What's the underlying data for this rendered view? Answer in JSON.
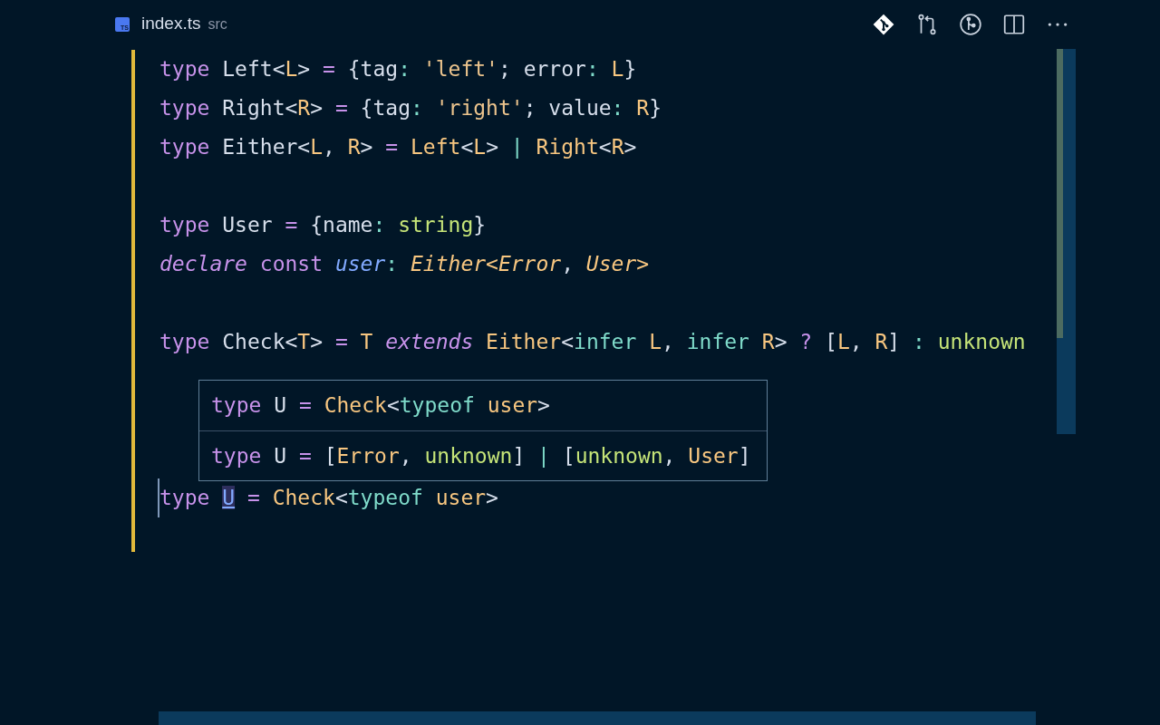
{
  "tab": {
    "filename": "index.ts",
    "folder": "src",
    "file_icon": "TS"
  },
  "lines": [
    {
      "kind": "code",
      "tokens": [
        {
          "kind": "kw",
          "text": "type"
        },
        {
          "kind": "pl",
          "text": " Left<"
        },
        {
          "kind": "gen",
          "text": "L"
        },
        {
          "kind": "pl",
          "text": ">"
        },
        {
          "kind": "op",
          "text": " ="
        },
        {
          "kind": "pl",
          "text": " {tag"
        },
        {
          "kind": "cy",
          "text": ":"
        },
        {
          "kind": "str",
          "text": " 'left'"
        },
        {
          "kind": "pl",
          "text": "; error"
        },
        {
          "kind": "cy",
          "text": ":"
        },
        {
          "kind": "gen",
          "text": " L"
        },
        {
          "kind": "pl",
          "text": "}"
        }
      ]
    },
    {
      "kind": "code",
      "tokens": [
        {
          "kind": "kw",
          "text": "type"
        },
        {
          "kind": "pl",
          "text": " Right<"
        },
        {
          "kind": "gen",
          "text": "R"
        },
        {
          "kind": "pl",
          "text": ">"
        },
        {
          "kind": "op",
          "text": " ="
        },
        {
          "kind": "pl",
          "text": " {tag"
        },
        {
          "kind": "cy",
          "text": ":"
        },
        {
          "kind": "str",
          "text": " 'right'"
        },
        {
          "kind": "pl",
          "text": "; value"
        },
        {
          "kind": "cy",
          "text": ":"
        },
        {
          "kind": "gen",
          "text": " R"
        },
        {
          "kind": "pl",
          "text": "}"
        }
      ]
    },
    {
      "kind": "code",
      "tokens": [
        {
          "kind": "kw",
          "text": "type"
        },
        {
          "kind": "pl",
          "text": " Either<"
        },
        {
          "kind": "gen",
          "text": "L"
        },
        {
          "kind": "pl",
          "text": ", "
        },
        {
          "kind": "gen",
          "text": "R"
        },
        {
          "kind": "pl",
          "text": ">"
        },
        {
          "kind": "op",
          "text": " ="
        },
        {
          "kind": "gen",
          "text": " Left"
        },
        {
          "kind": "pl",
          "text": "<"
        },
        {
          "kind": "gen",
          "text": "L"
        },
        {
          "kind": "pl",
          "text": ">"
        },
        {
          "kind": "cy",
          "text": " |"
        },
        {
          "kind": "gen",
          "text": " Right"
        },
        {
          "kind": "pl",
          "text": "<"
        },
        {
          "kind": "gen",
          "text": "R"
        },
        {
          "kind": "pl",
          "text": ">"
        }
      ]
    },
    {
      "kind": "blank"
    },
    {
      "kind": "code",
      "tokens": [
        {
          "kind": "kw",
          "text": "type"
        },
        {
          "kind": "pl",
          "text": " User"
        },
        {
          "kind": "op",
          "text": " ="
        },
        {
          "kind": "pl",
          "text": " {name"
        },
        {
          "kind": "cy",
          "text": ":"
        },
        {
          "kind": "prim",
          "text": " string"
        },
        {
          "kind": "pl",
          "text": "}"
        }
      ]
    },
    {
      "kind": "code",
      "tokens": [
        {
          "kind": "kwi",
          "text": "declare"
        },
        {
          "kind": "kw",
          "text": " const"
        },
        {
          "kind": "var",
          "text": " user"
        },
        {
          "kind": "cy",
          "text": ":"
        },
        {
          "kind": "geni",
          "text": " Either<Error"
        },
        {
          "kind": "pl",
          "text": ", "
        },
        {
          "kind": "geni",
          "text": "User>"
        }
      ]
    },
    {
      "kind": "blank"
    },
    {
      "kind": "code",
      "tokens": [
        {
          "kind": "kw",
          "text": "type"
        },
        {
          "kind": "pl",
          "text": " Check<"
        },
        {
          "kind": "gen",
          "text": "T"
        },
        {
          "kind": "pl",
          "text": ">"
        },
        {
          "kind": "op",
          "text": " ="
        },
        {
          "kind": "gen",
          "text": " T"
        },
        {
          "kind": "kwi",
          "text": " extends"
        },
        {
          "kind": "gen",
          "text": " Either"
        },
        {
          "kind": "pl",
          "text": "<"
        },
        {
          "kind": "cy",
          "text": "infer"
        },
        {
          "kind": "gen",
          "text": " L"
        },
        {
          "kind": "pl",
          "text": ", "
        },
        {
          "kind": "cy",
          "text": "infer"
        },
        {
          "kind": "gen",
          "text": " R"
        },
        {
          "kind": "pl",
          "text": ">"
        },
        {
          "kind": "op",
          "text": " ?"
        },
        {
          "kind": "pl",
          "text": " ["
        },
        {
          "kind": "gen",
          "text": "L"
        },
        {
          "kind": "pl",
          "text": ", "
        },
        {
          "kind": "gen",
          "text": "R"
        },
        {
          "kind": "pl",
          "text": "]"
        },
        {
          "kind": "cy",
          "text": " :"
        },
        {
          "kind": "prim",
          "text": " unknown"
        }
      ]
    },
    {
      "kind": "blank"
    },
    {
      "kind": "blank"
    },
    {
      "kind": "blank"
    },
    {
      "kind": "code",
      "cursor": true,
      "tokens": [
        {
          "kind": "kw",
          "text": "type "
        },
        {
          "kind": "hl",
          "text": "U"
        },
        {
          "kind": "op",
          "text": " ="
        },
        {
          "kind": "gen",
          "text": " Check"
        },
        {
          "kind": "pl",
          "text": "<"
        },
        {
          "kind": "cy",
          "text": "typeof"
        },
        {
          "kind": "gen",
          "text": " user"
        },
        {
          "kind": "pl",
          "text": ">"
        }
      ]
    }
  ],
  "hover": {
    "rows": [
      {
        "tokens": [
          {
            "kind": "kw",
            "text": "type"
          },
          {
            "kind": "pl",
            "text": " U"
          },
          {
            "kind": "op",
            "text": " ="
          },
          {
            "kind": "gen",
            "text": " Check"
          },
          {
            "kind": "pl",
            "text": "<"
          },
          {
            "kind": "cy",
            "text": "typeof"
          },
          {
            "kind": "gen",
            "text": " user"
          },
          {
            "kind": "pl",
            "text": ">"
          }
        ]
      },
      {
        "tokens": [
          {
            "kind": "kw",
            "text": "type"
          },
          {
            "kind": "pl",
            "text": " U"
          },
          {
            "kind": "op",
            "text": " ="
          },
          {
            "kind": "pl",
            "text": " ["
          },
          {
            "kind": "gen",
            "text": "Error"
          },
          {
            "kind": "pl",
            "text": ", "
          },
          {
            "kind": "prim",
            "text": "unknown"
          },
          {
            "kind": "pl",
            "text": "]"
          },
          {
            "kind": "cy",
            "text": " |"
          },
          {
            "kind": "pl",
            "text": " ["
          },
          {
            "kind": "prim",
            "text": "unknown"
          },
          {
            "kind": "pl",
            "text": ", "
          },
          {
            "kind": "gen",
            "text": "User"
          },
          {
            "kind": "pl",
            "text": "]"
          }
        ]
      }
    ]
  }
}
